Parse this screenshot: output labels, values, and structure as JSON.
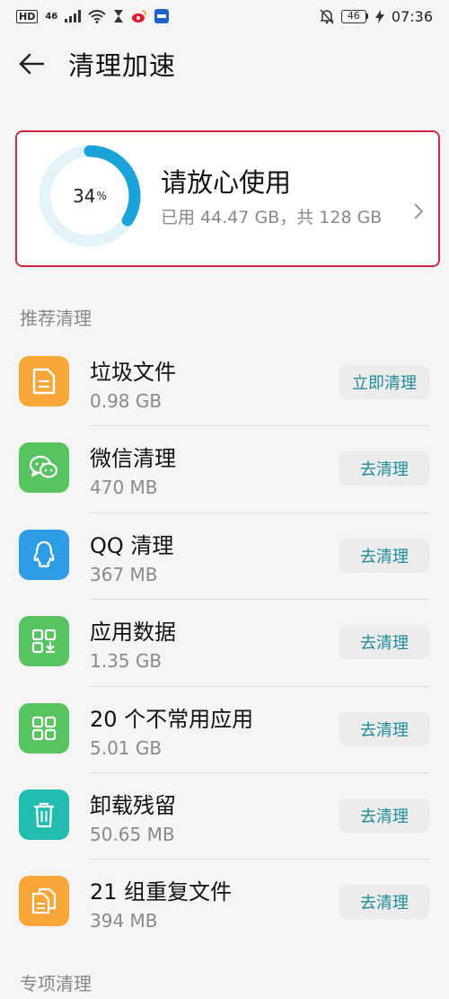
{
  "status_bar": {
    "left_badges": [
      "HD",
      "46"
    ],
    "battery": "46",
    "time": "07:36"
  },
  "header": {
    "title": "清理加速"
  },
  "storage": {
    "percent": "34",
    "percent_sign": "%",
    "fraction": 0.34,
    "title": "请放心使用",
    "detail": "已用 44.47 GB，共 128 GB"
  },
  "recommended": {
    "label": "推荐清理",
    "items": [
      {
        "icon": "file-icon",
        "color": "#f8a637",
        "title": "垃圾文件",
        "size": "0.98 GB",
        "action": "立即清理"
      },
      {
        "icon": "wechat-icon",
        "color": "#57c460",
        "title": "微信清理",
        "size": "470 MB",
        "action": "去清理"
      },
      {
        "icon": "qq-icon",
        "color": "#2f9ce8",
        "title": "QQ 清理",
        "size": "367 MB",
        "action": "去清理"
      },
      {
        "icon": "app-data-icon",
        "color": "#57c460",
        "title": "应用数据",
        "size": "1.35 GB",
        "action": "去清理"
      },
      {
        "icon": "apps-grid-icon",
        "color": "#57c460",
        "title": "20 个不常用应用",
        "size": "5.01 GB",
        "action": "去清理"
      },
      {
        "icon": "trash-icon",
        "color": "#21bdb0",
        "title": "卸载残留",
        "size": "50.65 MB",
        "action": "去清理"
      },
      {
        "icon": "duplicate-files-icon",
        "color": "#f8a637",
        "title": "21 组重复文件",
        "size": "394 MB",
        "action": "去清理"
      }
    ]
  },
  "special": {
    "label": "专项清理"
  }
}
